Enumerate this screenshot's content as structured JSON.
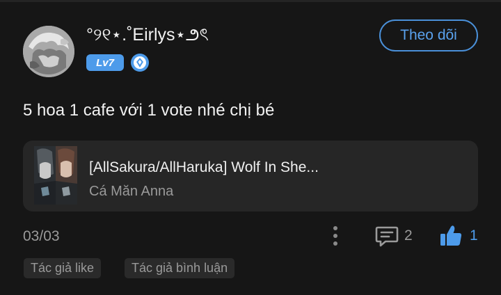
{
  "comment": {
    "username": "°୨୧⋆.˚Eirlys⋆౨ৎ",
    "level_badge": "Lv7",
    "follow_label": "Theo dõi",
    "text": "5 hoa 1 cafe với 1 vote nhé chị bé",
    "date": "03/03",
    "reply_count": "2",
    "like_count": "1"
  },
  "story": {
    "title": "[AllSakura/AllHaruka] Wolf In She...",
    "author": "Cá Măn Anna"
  },
  "tags": [
    "Tác giả like",
    "Tác giả bình luận"
  ],
  "icons": {
    "verified": "verified-badge-icon",
    "more": "more-vertical-icon",
    "reply": "comment-icon",
    "like": "thumbs-up-icon"
  },
  "colors": {
    "background": "#161616",
    "accent": "#4d9bea",
    "text_primary": "#f2f2f2",
    "text_secondary": "#9a9a9a",
    "card": "#262626"
  }
}
